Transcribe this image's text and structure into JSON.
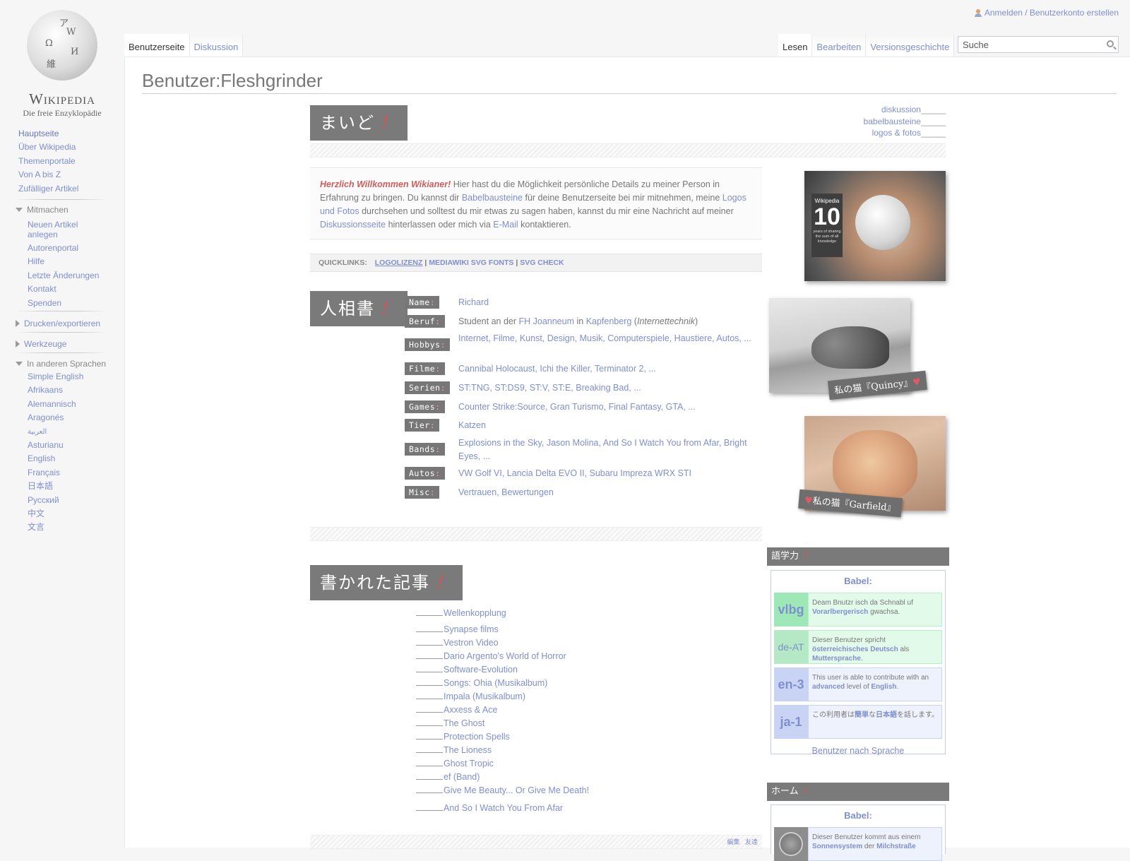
{
  "logo": {
    "wordmark": "Wikipedia",
    "tagline": "Die freie Enzyklopädie",
    "glyphs": [
      "Ω",
      "W",
      "И",
      "維",
      "ア"
    ]
  },
  "sidebar": {
    "nav": [
      "Hauptseite",
      "Über Wikipedia",
      "Themenportale",
      "Von A bis Z",
      "Zufälliger Artikel"
    ],
    "mitmachen_label": "Mitmachen",
    "mitmachen": [
      "Neuen Artikel anlegen",
      "Autorenportal",
      "Hilfe",
      "Letzte Änderungen",
      "Kontakt",
      "Spenden"
    ],
    "drucken_label": "Drucken/exportieren",
    "werkzeuge_label": "Werkzeuge",
    "sprachen_label": "In anderen Sprachen",
    "sprachen": [
      "Simple English",
      "Afrikaans",
      "Alemannisch",
      "Aragonés",
      "العربية",
      "Asturianu",
      "English",
      "Français",
      "日本語",
      "Русский",
      "中文",
      "文言"
    ]
  },
  "personal": {
    "login": "Anmelden / Benutzerkonto erstellen"
  },
  "tabs": {
    "left": [
      "Benutzerseite",
      "Diskussion"
    ],
    "right": [
      "Lesen",
      "Bearbeiten",
      "Versionsgeschichte"
    ]
  },
  "search": {
    "placeholder": "Suche"
  },
  "page": {
    "title": "Benutzer:Fleshgrinder",
    "heading1": "まいど",
    "heading2": "人相書",
    "heading3": "書かれた記事",
    "bang": "！",
    "toplinks": [
      "diskussion",
      "babelbausteine",
      "logos & fotos"
    ],
    "toplink_underscore": "______"
  },
  "welcome": {
    "greeting": "Herzlich Willkommen Wikianer!",
    "t1": " Hier hast du die Möglichkeit persönliche Details zu meiner Person in Erfahrung zu bringen. Du kannst dir ",
    "l1": "Babelbausteine",
    "t2": " für deine Benutzerseite bei mir mitnehmen, meine ",
    "l2": "Logos und Fotos",
    "t3": " durchsehen und solltest du mir etwas zu sagen haben, kannst du mir eine Nachricht auf meiner ",
    "l3": "Diskussionsseite",
    "t4": " hinterlassen oder mich via ",
    "l4": "E-Mail",
    "t5": " kontaktieren."
  },
  "quicklinks": {
    "label": "QUICKLINKS:",
    "links": [
      "LOGOLIZENZ",
      "MEDIAWIKI SVG FONTS",
      "SVG CHECK"
    ],
    "sep": "|"
  },
  "photos": {
    "badge_title": "Wikipedia",
    "badge_num": "10",
    "badge_text": "years of sharing the sum of all knowledge",
    "caption_q": "私の猫『Quincy』",
    "caption_g": "私の猫『Garfield』",
    "heart": "♥"
  },
  "profile": {
    "rows": [
      {
        "key": "Name",
        "value": "Richard"
      },
      {
        "key": "Beruf",
        "value_parts": [
          "Student",
          " an der ",
          "FH Joanneum",
          " in ",
          "Kapfenberg",
          " (",
          "Internettechnik",
          ")"
        ]
      },
      {
        "key": "Hobbys",
        "value": "Internet, Filme, Kunst, Design, Musik, Computerspiele, Haustiere, Autos, ..."
      },
      {
        "key": "Filme",
        "value": "Cannibal Holocaust, Ichi the Killer, Terminator 2, ..."
      },
      {
        "key": "Serien",
        "value": "ST:TNG, ST:DS9, ST:V, ST:E, Breaking Bad, ..."
      },
      {
        "key": "Games",
        "value": "Counter Strike:Source, Gran Turismo, Final Fantasy, GTA, ..."
      },
      {
        "key": "Tier",
        "value": "Katzen"
      },
      {
        "key": "Bands",
        "value": "Explosions in the Sky, Jason Molina, And So I Watch You from Afar, Bright Eyes, ..."
      },
      {
        "key": "Autos",
        "value": "VW Golf VI, Lancia Delta EVO II, Subaru Impreza WRX STI"
      },
      {
        "key": "Misc",
        "value": "Vertrauen, Bewertungen"
      }
    ],
    "colon": ":"
  },
  "articles": [
    "Wellenkopplung",
    "Synapse films",
    "Vestron Video",
    "Dario Argento's World of Horror",
    "Software-Evolution",
    "Songs: Ohia (Musikalbum)",
    "Impala (Musikalbum)",
    "Axxess & Ace",
    "The Ghost",
    "Protection Spells",
    "The Lioness",
    "Ghost Tropic",
    "ef (Band)",
    "Give Me Beauty... Or Give Me Death!",
    "And So I Watch You From Afar"
  ],
  "babel": {
    "head1": "語学力",
    "head2": "ホーム",
    "title": "Babel:",
    "items": [
      {
        "code": "vlbg",
        "pre": "Deam Bnutzr isch da Schnabl uf ",
        "bold": "Vorarlbergerisch",
        "post": " gwachsa."
      },
      {
        "code": "de-AT",
        "pre": "Dieser Benutzer spricht ",
        "bold": "österreichisches Deutsch",
        "mid": " als ",
        "bold2": "Muttersprache",
        "post": "."
      },
      {
        "code": "en-3",
        "pre": "This user is able to contribute with an ",
        "bold": "advanced",
        "mid": " level of ",
        "bold2": "English",
        "post": "."
      },
      {
        "code": "ja-1",
        "pre": "この利用者は",
        "bold": "簡単",
        "mid": "な",
        "bold2": "日本語",
        "post": "を話します。"
      }
    ],
    "footer": "Benutzer nach Sprache",
    "home_pre": "Dieser Benutzer kommt aus einem ",
    "home_bold": "Sonnensystem",
    "home_mid": " der ",
    "home_bold2": "Milchstraße"
  },
  "footer_stripe": {
    "left": "編集",
    "right": "友達"
  },
  "colors": {
    "link": "#7f8fd0",
    "heading_bg": "#7a7a7a",
    "accent_red": "#d9534f"
  }
}
